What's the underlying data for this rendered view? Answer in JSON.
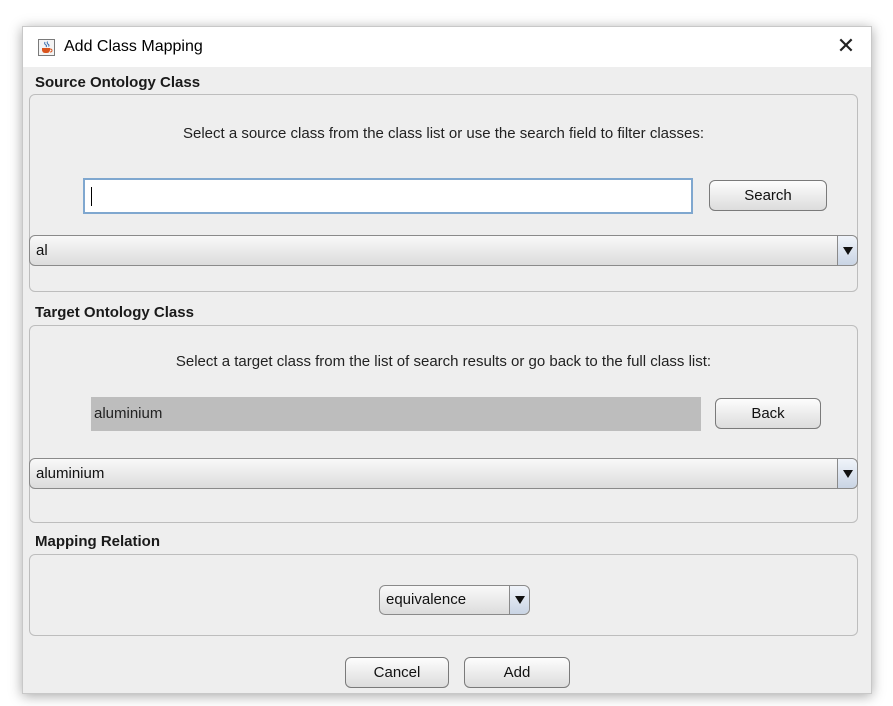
{
  "window": {
    "title": "Add Class Mapping",
    "close_glyph": "✕",
    "app_icon": "java-coffee-cup-icon"
  },
  "source": {
    "section_title": "Source Ontology Class",
    "instruction": "Select a source class from the class list or use the search field to filter classes:",
    "search_value": "",
    "search_button": "Search",
    "class_combo_value": "al"
  },
  "target": {
    "section_title": "Target Ontology Class",
    "instruction": "Select a target class from the list of search results or go back to the full class list:",
    "search_result_value": "aluminium",
    "back_button": "Back",
    "class_combo_value": "aluminium"
  },
  "relation": {
    "section_title": "Mapping Relation",
    "combo_value": "equivalence"
  },
  "footer": {
    "cancel_button": "Cancel",
    "add_button": "Add"
  },
  "colors": {
    "dialog_bg": "#eeeeee",
    "focus_border": "#7fa7cf",
    "readonly_field_bg": "#bdbdbd",
    "arrow_bg": "#c9d4e4"
  }
}
